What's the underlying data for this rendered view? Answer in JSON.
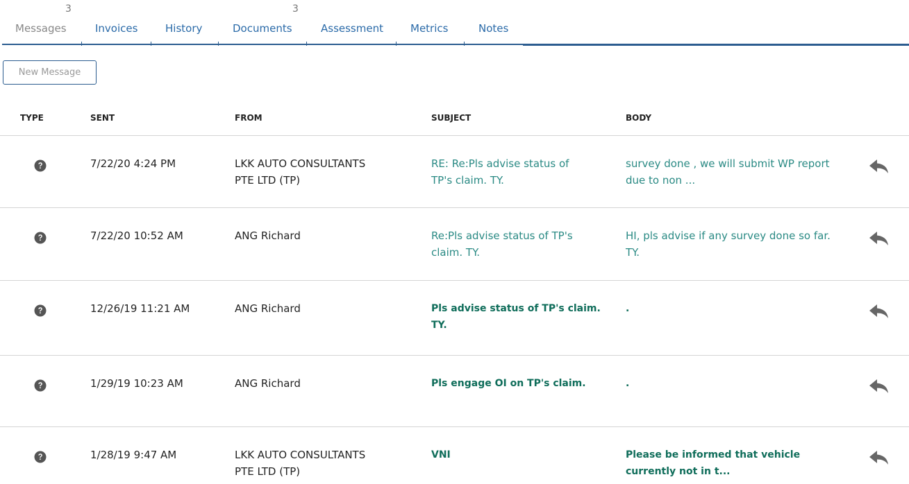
{
  "tabs": [
    {
      "label": "Messages",
      "badge": "3",
      "active": true
    },
    {
      "label": "Invoices",
      "badge": "",
      "active": false
    },
    {
      "label": "History",
      "badge": "",
      "active": false
    },
    {
      "label": "Documents",
      "badge": "3",
      "active": false
    },
    {
      "label": "Assessment",
      "badge": "",
      "active": false
    },
    {
      "label": "Metrics",
      "badge": "",
      "active": false
    },
    {
      "label": "Notes",
      "badge": "",
      "active": false
    }
  ],
  "toolbar": {
    "new_message_label": "New Message"
  },
  "table": {
    "columns": [
      "TYPE",
      "SENT",
      "FROM",
      "SUBJECT",
      "BODY"
    ],
    "rows": [
      {
        "type_icon": "question-circle-icon",
        "sent": "7/22/20 4:24 PM",
        "from_1": "LKK AUTO CONSULTANTS",
        "from_2": "PTE LTD (TP)",
        "subject_1": "RE: Re:Pls advise status of",
        "subject_2": "TP's claim. TY.",
        "body_1": "survey done , we will submit WP report",
        "body_2": "due to non ...",
        "unread": false
      },
      {
        "type_icon": "question-circle-icon",
        "sent": "7/22/20 10:52 AM",
        "from_1": "ANG Richard",
        "from_2": "",
        "subject_1": "Re:Pls advise status of TP's",
        "subject_2": "claim. TY.",
        "body_1": "HI, pls advise if any survey done so far.",
        "body_2": "TY.",
        "unread": false
      },
      {
        "type_icon": "question-circle-icon",
        "sent": "12/26/19 11:21 AM",
        "from_1": "ANG Richard",
        "from_2": "",
        "subject_1": "Pls advise status of TP's claim.",
        "subject_2": "TY.",
        "body_1": ".",
        "body_2": "",
        "unread": true
      },
      {
        "type_icon": "question-circle-icon",
        "sent": "1/29/19 10:23 AM",
        "from_1": "ANG Richard",
        "from_2": "",
        "subject_1": "Pls engage OI on TP's claim.",
        "subject_2": "",
        "body_1": ".",
        "body_2": "",
        "unread": true
      },
      {
        "type_icon": "question-circle-icon",
        "sent": "1/28/19 9:47 AM",
        "from_1": "LKK AUTO CONSULTANTS",
        "from_2": "PTE LTD (TP)",
        "subject_1": "VNI",
        "subject_2": "",
        "body_1": "Please be informed that vehicle",
        "body_2": "currently not in t...",
        "unread": true
      }
    ]
  },
  "colors": {
    "accent": "#2b5c8f",
    "link": "#2a6aa8",
    "subject": "#2a8a84",
    "subject_unread": "#0f6d5a"
  }
}
